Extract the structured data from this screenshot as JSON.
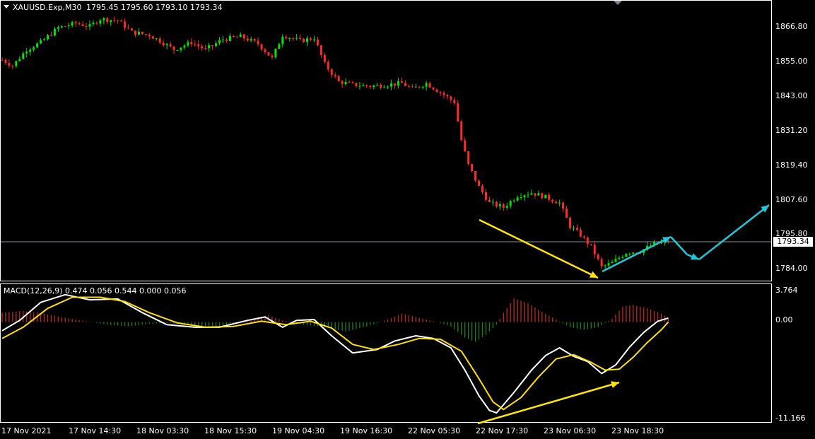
{
  "window": {
    "symbol_caption": "XAUUSD.Exp,M30",
    "ohlc_caption": "1795.45 1795.60 1793.10 1793.34"
  },
  "indicator": {
    "caption": "MACD(12,26,9) 0.474 0.056 0.544 0.000 0.056"
  },
  "price_axis": {
    "ticks": [
      "1866.80",
      "1855.00",
      "1843.00",
      "1831.20",
      "1819.40",
      "1807.60",
      "1795.80",
      "1784.00"
    ],
    "current_price": "1793.34"
  },
  "macd_axis": {
    "ticks": [
      "3.764",
      "0.00",
      "-11.166"
    ]
  },
  "time_axis": {
    "ticks": [
      "17 Nov 2021",
      "17 Nov 14:30",
      "18 Nov 03:30",
      "18 Nov 15:30",
      "19 Nov 04:30",
      "19 Nov 16:30",
      "22 Nov 05:30",
      "22 Nov 17:30",
      "23 Nov 06:30",
      "23 Nov 18:30"
    ]
  },
  "colors": {
    "background": "#000000",
    "bull_candle": "#00e600",
    "bear_candle": "#ff2a2a",
    "macd_line": "#ffffff",
    "signal_line": "#ffe000",
    "hist_positive": "#b02a20",
    "hist_negative": "#1c7a1c",
    "annotation_yellow": "#ffe600",
    "annotation_cyan": "#1ec8d8",
    "grid_line": "#8a8f99"
  },
  "chart_data": [
    {
      "type": "candlestick",
      "title": "XAUUSD.Exp,M30",
      "ylim": [
        1780.5,
        1873.5
      ],
      "close_path": [
        {
          "t": 0,
          "p": 1855.5
        },
        {
          "t": 3,
          "p": 1853.5
        },
        {
          "t": 7,
          "p": 1859.0
        },
        {
          "t": 11,
          "p": 1861.5
        },
        {
          "t": 16,
          "p": 1866.5
        },
        {
          "t": 21,
          "p": 1868.0
        },
        {
          "t": 25,
          "p": 1867.0
        },
        {
          "t": 28,
          "p": 1869.5
        },
        {
          "t": 33,
          "p": 1869.0
        },
        {
          "t": 37,
          "p": 1865.0
        },
        {
          "t": 42,
          "p": 1864.0
        },
        {
          "t": 45,
          "p": 1862.0
        },
        {
          "t": 49,
          "p": 1859.0
        },
        {
          "t": 54,
          "p": 1861.5
        },
        {
          "t": 58,
          "p": 1859.0
        },
        {
          "t": 63,
          "p": 1862.5
        },
        {
          "t": 68,
          "p": 1863.5
        },
        {
          "t": 73,
          "p": 1861.0
        },
        {
          "t": 77,
          "p": 1856.0
        },
        {
          "t": 80,
          "p": 1864.0
        },
        {
          "t": 85,
          "p": 1862.0
        },
        {
          "t": 89,
          "p": 1863.0
        },
        {
          "t": 92,
          "p": 1854.0
        },
        {
          "t": 96,
          "p": 1848.0
        },
        {
          "t": 100,
          "p": 1847.0
        },
        {
          "t": 105,
          "p": 1846.5
        },
        {
          "t": 110,
          "p": 1847.0
        },
        {
          "t": 114,
          "p": 1847.5
        },
        {
          "t": 117,
          "p": 1845.5
        },
        {
          "t": 121,
          "p": 1847.5
        },
        {
          "t": 126,
          "p": 1843.5
        },
        {
          "t": 129,
          "p": 1841.0
        },
        {
          "t": 131,
          "p": 1828.0
        },
        {
          "t": 133,
          "p": 1819.5
        },
        {
          "t": 136,
          "p": 1812.0
        },
        {
          "t": 139,
          "p": 1806.5
        },
        {
          "t": 143,
          "p": 1805.0
        },
        {
          "t": 147,
          "p": 1809.0
        },
        {
          "t": 151,
          "p": 1810.0
        },
        {
          "t": 155,
          "p": 1808.5
        },
        {
          "t": 159,
          "p": 1806.5
        },
        {
          "t": 162,
          "p": 1798.5
        },
        {
          "t": 165,
          "p": 1795.5
        },
        {
          "t": 168,
          "p": 1791.5
        },
        {
          "t": 171,
          "p": 1784.5
        },
        {
          "t": 174,
          "p": 1786.0
        },
        {
          "t": 178,
          "p": 1789.5
        },
        {
          "t": 182,
          "p": 1790.0
        },
        {
          "t": 186,
          "p": 1792.5
        },
        {
          "t": 190,
          "p": 1793.34
        }
      ]
    },
    {
      "type": "line",
      "title": "MACD(12,26,9)",
      "ylim": [
        -11.166,
        3.764
      ],
      "series": [
        {
          "name": "MACD",
          "points": [
            {
              "t": 0,
              "v": -1.0
            },
            {
              "t": 5,
              "v": 0.2
            },
            {
              "t": 11,
              "v": 2.3
            },
            {
              "t": 18,
              "v": 3.2
            },
            {
              "t": 25,
              "v": 2.6
            },
            {
              "t": 33,
              "v": 2.7
            },
            {
              "t": 40,
              "v": 1.1
            },
            {
              "t": 47,
              "v": -0.3
            },
            {
              "t": 55,
              "v": -0.6
            },
            {
              "t": 62,
              "v": -0.6
            },
            {
              "t": 70,
              "v": 0.2
            },
            {
              "t": 75,
              "v": 0.6
            },
            {
              "t": 80,
              "v": -0.6
            },
            {
              "t": 84,
              "v": 0.2
            },
            {
              "t": 89,
              "v": 0.3
            },
            {
              "t": 94,
              "v": -1.6
            },
            {
              "t": 100,
              "v": -3.6
            },
            {
              "t": 107,
              "v": -3.2
            },
            {
              "t": 112,
              "v": -2.2
            },
            {
              "t": 118,
              "v": -1.6
            },
            {
              "t": 123,
              "v": -1.9
            },
            {
              "t": 128,
              "v": -3.0
            },
            {
              "t": 132,
              "v": -5.6
            },
            {
              "t": 136,
              "v": -8.6
            },
            {
              "t": 139,
              "v": -10.3
            },
            {
              "t": 141,
              "v": -10.6
            },
            {
              "t": 146,
              "v": -8.2
            },
            {
              "t": 151,
              "v": -5.6
            },
            {
              "t": 155,
              "v": -3.9
            },
            {
              "t": 159,
              "v": -3.0
            },
            {
              "t": 163,
              "v": -4.0
            },
            {
              "t": 167,
              "v": -4.6
            },
            {
              "t": 171,
              "v": -6.0
            },
            {
              "t": 175,
              "v": -5.0
            },
            {
              "t": 179,
              "v": -2.9
            },
            {
              "t": 183,
              "v": -1.2
            },
            {
              "t": 187,
              "v": 0.1
            },
            {
              "t": 190,
              "v": 0.474
            }
          ]
        },
        {
          "name": "Signal",
          "points": [
            {
              "t": 0,
              "v": -1.9
            },
            {
              "t": 6,
              "v": -0.6
            },
            {
              "t": 13,
              "v": 1.6
            },
            {
              "t": 20,
              "v": 2.9
            },
            {
              "t": 28,
              "v": 2.9
            },
            {
              "t": 35,
              "v": 2.4
            },
            {
              "t": 42,
              "v": 1.1
            },
            {
              "t": 50,
              "v": -0.1
            },
            {
              "t": 58,
              "v": -0.6
            },
            {
              "t": 66,
              "v": -0.5
            },
            {
              "t": 74,
              "v": 0.1
            },
            {
              "t": 81,
              "v": -0.3
            },
            {
              "t": 88,
              "v": 0.1
            },
            {
              "t": 94,
              "v": -0.7
            },
            {
              "t": 100,
              "v": -2.6
            },
            {
              "t": 106,
              "v": -3.2
            },
            {
              "t": 113,
              "v": -2.6
            },
            {
              "t": 119,
              "v": -1.9
            },
            {
              "t": 125,
              "v": -2.0
            },
            {
              "t": 131,
              "v": -3.4
            },
            {
              "t": 136,
              "v": -6.6
            },
            {
              "t": 140,
              "v": -9.3
            },
            {
              "t": 143,
              "v": -10.2
            },
            {
              "t": 148,
              "v": -8.8
            },
            {
              "t": 153,
              "v": -6.4
            },
            {
              "t": 158,
              "v": -4.3
            },
            {
              "t": 163,
              "v": -3.8
            },
            {
              "t": 168,
              "v": -4.7
            },
            {
              "t": 172,
              "v": -5.6
            },
            {
              "t": 176,
              "v": -5.5
            },
            {
              "t": 180,
              "v": -4.1
            },
            {
              "t": 184,
              "v": -2.4
            },
            {
              "t": 188,
              "v": -0.9
            },
            {
              "t": 190,
              "v": 0.0
            }
          ]
        }
      ],
      "histogram": [
        {
          "t": 0,
          "v": 1.1
        },
        {
          "t": 6,
          "v": 1.3
        },
        {
          "t": 12,
          "v": 1.0
        },
        {
          "t": 18,
          "v": 0.5
        },
        {
          "t": 24,
          "v": 0.1
        },
        {
          "t": 30,
          "v": -0.3
        },
        {
          "t": 36,
          "v": -0.5
        },
        {
          "t": 42,
          "v": -0.2
        },
        {
          "t": 48,
          "v": -0.1
        },
        {
          "t": 54,
          "v": -0.4
        },
        {
          "t": 60,
          "v": -0.6
        },
        {
          "t": 66,
          "v": -0.3
        },
        {
          "t": 72,
          "v": 0.5
        },
        {
          "t": 76,
          "v": 0.8
        },
        {
          "t": 80,
          "v": 0.2
        },
        {
          "t": 86,
          "v": -0.3
        },
        {
          "t": 92,
          "v": -0.6
        },
        {
          "t": 98,
          "v": -1.1
        },
        {
          "t": 104,
          "v": -0.5
        },
        {
          "t": 110,
          "v": 0.3
        },
        {
          "t": 114,
          "v": 1.0
        },
        {
          "t": 118,
          "v": 0.6
        },
        {
          "t": 124,
          "v": 0.0
        },
        {
          "t": 128,
          "v": -0.5
        },
        {
          "t": 132,
          "v": -1.8
        },
        {
          "t": 135,
          "v": -2.3
        },
        {
          "t": 138,
          "v": -1.5
        },
        {
          "t": 141,
          "v": -0.3
        },
        {
          "t": 143,
          "v": 1.1
        },
        {
          "t": 146,
          "v": 2.8
        },
        {
          "t": 150,
          "v": 2.2
        },
        {
          "t": 154,
          "v": 1.2
        },
        {
          "t": 158,
          "v": 0.3
        },
        {
          "t": 162,
          "v": -0.6
        },
        {
          "t": 166,
          "v": -0.9
        },
        {
          "t": 170,
          "v": -0.6
        },
        {
          "t": 174,
          "v": 0.4
        },
        {
          "t": 177,
          "v": 1.8
        },
        {
          "t": 180,
          "v": 2.0
        },
        {
          "t": 184,
          "v": 1.6
        },
        {
          "t": 188,
          "v": 1.0
        },
        {
          "t": 190,
          "v": 0.5
        }
      ]
    }
  ]
}
